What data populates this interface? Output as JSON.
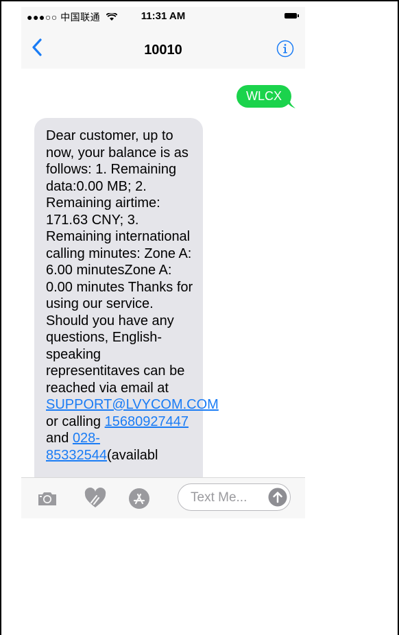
{
  "status_bar": {
    "carrier": "●●●○○ 中国联通",
    "time": "11:31 AM",
    "icons": [
      "wifi-icon",
      "battery-icon"
    ]
  },
  "nav": {
    "title": "10010",
    "back_icon": "chevron-left-icon",
    "info_icon": "info-icon",
    "accent_color": "#1a7cf5"
  },
  "sent_message": {
    "text": "WLCX",
    "color": "#1bd34c"
  },
  "received_message": {
    "text_1": "Dear customer, up to now, your balance is as follows:  1. Remaining data:0.00 MB;  2. Remaining airtime: 171.63 CNY;  3. Remaining international calling minutes:  Zone A: 6.00 minutesZone A: 0.00 minutes  Thanks for using our service. Should you have any questions, English-speaking representitaves can be reached via email at ",
    "email": "SUPPORT@LVYCOM.COM",
    "text_2": "  or calling ",
    "phone_1": "15680927447",
    "text_3": " and ",
    "phone_2": "028-85332544",
    "text_4": "(availabl",
    "color": "#e5e5ea"
  },
  "input_bar": {
    "placeholder": "Text Me...",
    "icons": [
      "camera-icon",
      "digital-touch-icon",
      "app-store-icon",
      "send-arrow-icon"
    ]
  }
}
